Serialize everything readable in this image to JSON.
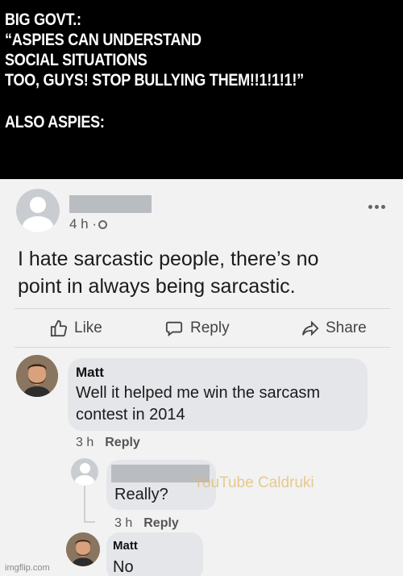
{
  "caption": {
    "line1": "BIG GOVT.:",
    "line2": "“ASPIES CAN UNDERSTAND",
    "line3": "SOCIAL SITUATIONS",
    "line4": "TOO, GUYS! STOP BULLYING THEM!!1!1!1!”",
    "line5": "ALSO ASPIES:"
  },
  "post": {
    "time": "4 h ·",
    "text_line1": "I hate sarcastic people, there’s no",
    "text_line2": "point in always being sarcastic.",
    "actions": {
      "like": "Like",
      "reply": "Reply",
      "share": "Share"
    }
  },
  "comments": [
    {
      "name": "Matt",
      "text_line1": "Well it helped me win the sarcasm",
      "text_line2": "contest in 2014",
      "time": "3 h",
      "reply": "Reply"
    },
    {
      "text": "Really?",
      "time": "3 h",
      "reply": "Reply"
    },
    {
      "name": "Matt",
      "text": "No"
    }
  ],
  "watermark": "YouTube Caldruki",
  "imgflip": "imgflip.com",
  "colors": {
    "caption_bg": "#000000",
    "caption_text": "#ffffff",
    "post_bg": "#f2f2f2",
    "bubble_bg": "#e4e6e9"
  }
}
